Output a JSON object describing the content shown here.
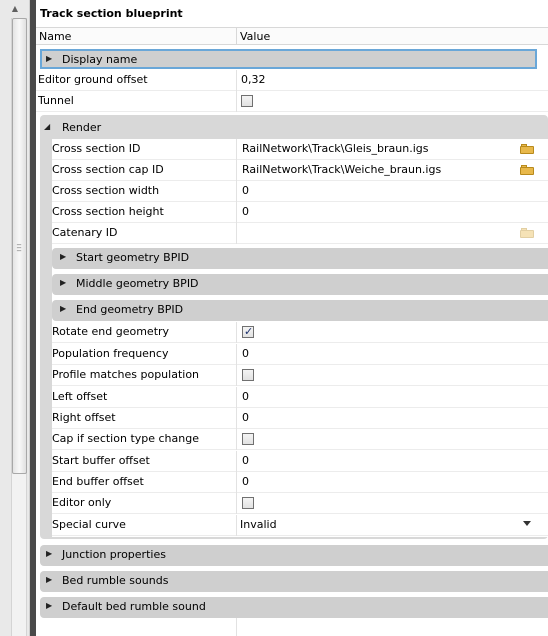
{
  "title": "Track section blueprint",
  "columns": {
    "name": "Name",
    "value": "Value"
  },
  "display_name": {
    "label": "Display name"
  },
  "top_props": [
    {
      "label": "Editor ground offset",
      "value": "0,32"
    },
    {
      "label": "Tunnel",
      "checked": false
    }
  ],
  "render": {
    "label": "Render",
    "cross_section_id": {
      "label": "Cross section ID",
      "value": "RailNetwork\\Track\\Gleis_braun.igs"
    },
    "cross_section_cap_id": {
      "label": "Cross section cap ID",
      "value": "RailNetwork\\Track\\Weiche_braun.igs"
    },
    "cross_section_width": {
      "label": "Cross section width",
      "value": "0"
    },
    "cross_section_height": {
      "label": "Cross section height",
      "value": "0"
    },
    "catenary_id": {
      "label": "Catenary ID",
      "value": ""
    },
    "start_geometry": {
      "label": "Start geometry BPID"
    },
    "middle_geometry": {
      "label": "Middle geometry BPID"
    },
    "end_geometry": {
      "label": "End geometry BPID"
    },
    "rotate_end_geometry": {
      "label": "Rotate end geometry",
      "checked": true
    },
    "population_frequency": {
      "label": "Population frequency",
      "value": "0"
    },
    "profile_matches_population": {
      "label": "Profile matches population",
      "checked": false
    },
    "left_offset": {
      "label": "Left offset",
      "value": "0"
    },
    "right_offset": {
      "label": "Right offset",
      "value": "0"
    },
    "cap_if_section_type_change": {
      "label": "Cap if section type change",
      "checked": false
    },
    "start_buffer_offset": {
      "label": "Start buffer offset",
      "value": "0"
    },
    "end_buffer_offset": {
      "label": "End buffer offset",
      "value": "0"
    },
    "editor_only": {
      "label": "Editor only",
      "checked": false
    },
    "special_curve": {
      "label": "Special curve",
      "value": "Invalid"
    }
  },
  "bottom_categories": {
    "junction": "Junction properties",
    "bed_rumble": "Bed rumble sounds",
    "default_bed_rumble": "Default bed rumble sound"
  },
  "icons": {
    "expand": "triangle-right-icon",
    "collapse": "triangle-down-icon",
    "folder": "folder-open-icon",
    "check": "checkmark-icon"
  },
  "colors": {
    "category_bg": "#cfcfcf",
    "selection_border": "#6aa7d8",
    "folder": "#e8b84a"
  }
}
